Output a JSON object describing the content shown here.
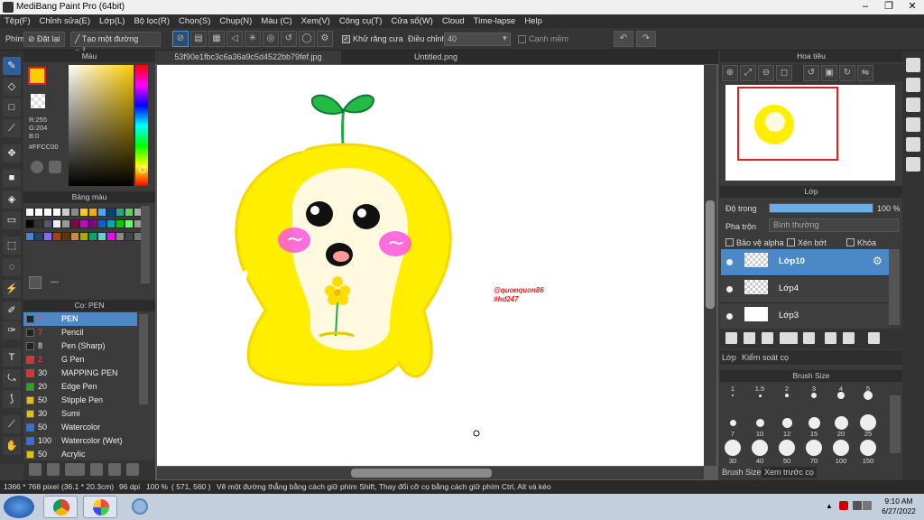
{
  "app": {
    "title": "MediBang Paint Pro (64bit)"
  },
  "menu": [
    "Tệp(F)",
    "Chỉnh sửa(E)",
    "Lớp(L)",
    "Bộ lọc(R)",
    "Chọn(S)",
    "Chụp(N)",
    "Màu (C)",
    "Xem(V)",
    "Công cụ(T)",
    "Cửa sổ(W)",
    "Cloud",
    "Time-lapse",
    "Help"
  ],
  "toolopts": {
    "phim": "Phím",
    "reset": "Đặt lại",
    "line": "Tạo một đường thẳng",
    "antialias": "Khử răng cưa",
    "adjust": "Điều chỉnh",
    "adjust_val": "40",
    "edge": "Cạnh mềm"
  },
  "color_panel": {
    "title": "Màu",
    "r": "R:255",
    "g": "G:204",
    "b": "B:0",
    "hex": "#FFCC00",
    "fg": "#ffcc00"
  },
  "palette_panel": {
    "title": "Bảng màu",
    "swatch_label": "---"
  },
  "brush_panel": {
    "title": "Cọ: PEN",
    "items": [
      {
        "size": "7",
        "name": "PEN",
        "color": "#222"
      },
      {
        "size": "7",
        "name": "Pencil",
        "color": "#222"
      },
      {
        "size": "8",
        "name": "Pen (Sharp)",
        "color": "#222"
      },
      {
        "size": "2",
        "name": "G Pen",
        "color": "#e03030"
      },
      {
        "size": "30",
        "name": "MAPPING PEN",
        "color": "#e03030"
      },
      {
        "size": "20",
        "name": "Edge Pen",
        "color": "#22aa22"
      },
      {
        "size": "50",
        "name": "Stipple Pen",
        "color": "#e0c020"
      },
      {
        "size": "30",
        "name": "Sumi",
        "color": "#e0c020"
      },
      {
        "size": "50",
        "name": "Watercolor",
        "color": "#3070e0"
      },
      {
        "size": "100",
        "name": "Watercolor (Wet)",
        "color": "#3070e0"
      },
      {
        "size": "50",
        "name": "Acrylic",
        "color": "#e0c020"
      }
    ]
  },
  "tabs": {
    "doc1": "53f90e1fbc3c6a36a9c5d4522bb79fef.jpg",
    "doc2": "Untitled.png"
  },
  "canvas": {
    "signature1": "@quonquon86",
    "signature2": "#hd247"
  },
  "navigator": {
    "title": "Hoa tiêu"
  },
  "layer_panel": {
    "title": "Lớp",
    "opacity_label": "Độ trong",
    "opacity_value": "100 %",
    "opacity": 1.0,
    "blend_label": "Pha trộn",
    "blend_value": "Bình thường",
    "protect_alpha": "Bảo vệ alpha",
    "clip": "Xén bớt",
    "lock": "Khóa",
    "layers": [
      "Lớp10",
      "Lớp4",
      "Lớp3"
    ],
    "tab_layer": "Lớp",
    "tab_brushctl": "Kiểm soát cọ"
  },
  "brush_size": {
    "title": "Brush Size",
    "sizes": [
      "1",
      "1.5",
      "2",
      "3",
      "4",
      "5",
      "7",
      "10",
      "12",
      "15",
      "20",
      "25",
      "30",
      "40",
      "50",
      "70",
      "100",
      "150"
    ],
    "tab1": "Brush Size",
    "tab2": "Xem trước cọ"
  },
  "status": {
    "dims": "1366 * 768 pixel",
    "phys": "(36.1 * 20.3cm)",
    "dpi": "96 dpi",
    "zoom": "100 %",
    "coords": "( 571, 560 )",
    "hint": "Vẽ một đường thẳng bằng cách giữ phím Shift, Thay đổi cỡ cọ bằng cách giữ phím Ctrl, Alt và kéo"
  },
  "taskbar": {
    "time": "9:10 AM",
    "date": "6/27/2022"
  }
}
